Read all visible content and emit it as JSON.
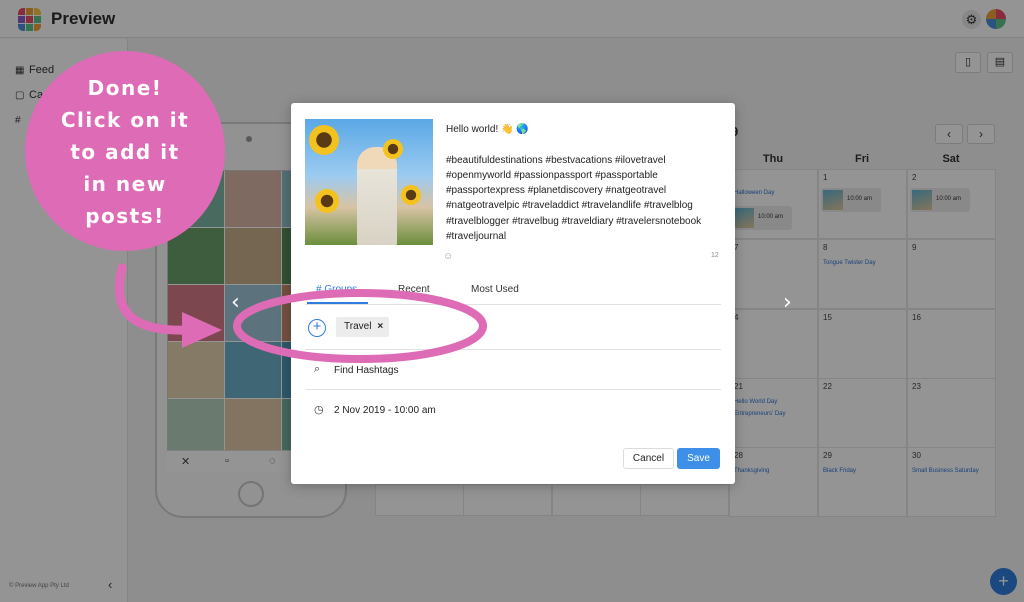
{
  "app": {
    "title": "Preview"
  },
  "sidebar": {
    "items": [
      {
        "label": "Feed",
        "icon": "grid-icon"
      },
      {
        "label": "Ca",
        "icon": "calendar-icon"
      },
      {
        "label": "",
        "icon": "hashtag-icon"
      }
    ],
    "copyright": "© Preview App Pty Ltd"
  },
  "calendar": {
    "month_fragment": "9",
    "days": [
      "Thu",
      "Fri",
      "Sat"
    ],
    "cells": [
      {
        "n": "",
        "event": "Halloween Day",
        "post": "10:00 am"
      },
      {
        "n": "1",
        "event": "",
        "post": "10:00 am"
      },
      {
        "n": "2",
        "event": "",
        "post": "10:00 am"
      },
      {
        "n": "7",
        "event": "",
        "post": ""
      },
      {
        "n": "8",
        "event": "Tongue Twister Day",
        "post": ""
      },
      {
        "n": "9",
        "event": "",
        "post": ""
      },
      {
        "n": "4",
        "event": "",
        "post": ""
      },
      {
        "n": "15",
        "event": "",
        "post": ""
      },
      {
        "n": "16",
        "event": "",
        "post": ""
      },
      {
        "n": "21",
        "event": "Hello World Day",
        "event2": "Entrepreneurs' Day",
        "post": ""
      },
      {
        "n": "22",
        "event": "",
        "post": ""
      },
      {
        "n": "23",
        "event": "",
        "post": ""
      },
      {
        "n": "28",
        "event": "Thanksgiving",
        "post": ""
      },
      {
        "n": "29",
        "event": "Black Friday",
        "post": ""
      },
      {
        "n": "30",
        "event": "Small Business Saturday",
        "post": ""
      }
    ]
  },
  "modal": {
    "caption": "Hello world! 👋 🌎\n\n#beautifuldestinations #bestvacations #ilovetravel #openmyworld #passionpassport #passportable #passportexpress #planetdiscovery #natgeotravel #natgeotravelpic #traveladdict #travelandlife #travelblog #travelblogger #travelbug #traveldiary #travelersnotebook #traveljournal",
    "char_count": "12",
    "tabs": [
      "# Groups",
      "Recent",
      "Most Used"
    ],
    "chip": "Travel",
    "find_hashtags": "Find Hashtags",
    "schedule": "2 Nov 2019 - 10:00 am",
    "cancel": "Cancel",
    "save": "Save"
  },
  "annotation": {
    "text": "Done!\nClick on it\nto add it\nin new\nposts!",
    "color": "#de6bb5"
  },
  "colors": {
    "accent": "#2f7ddf",
    "save": "#3d8fe8"
  }
}
